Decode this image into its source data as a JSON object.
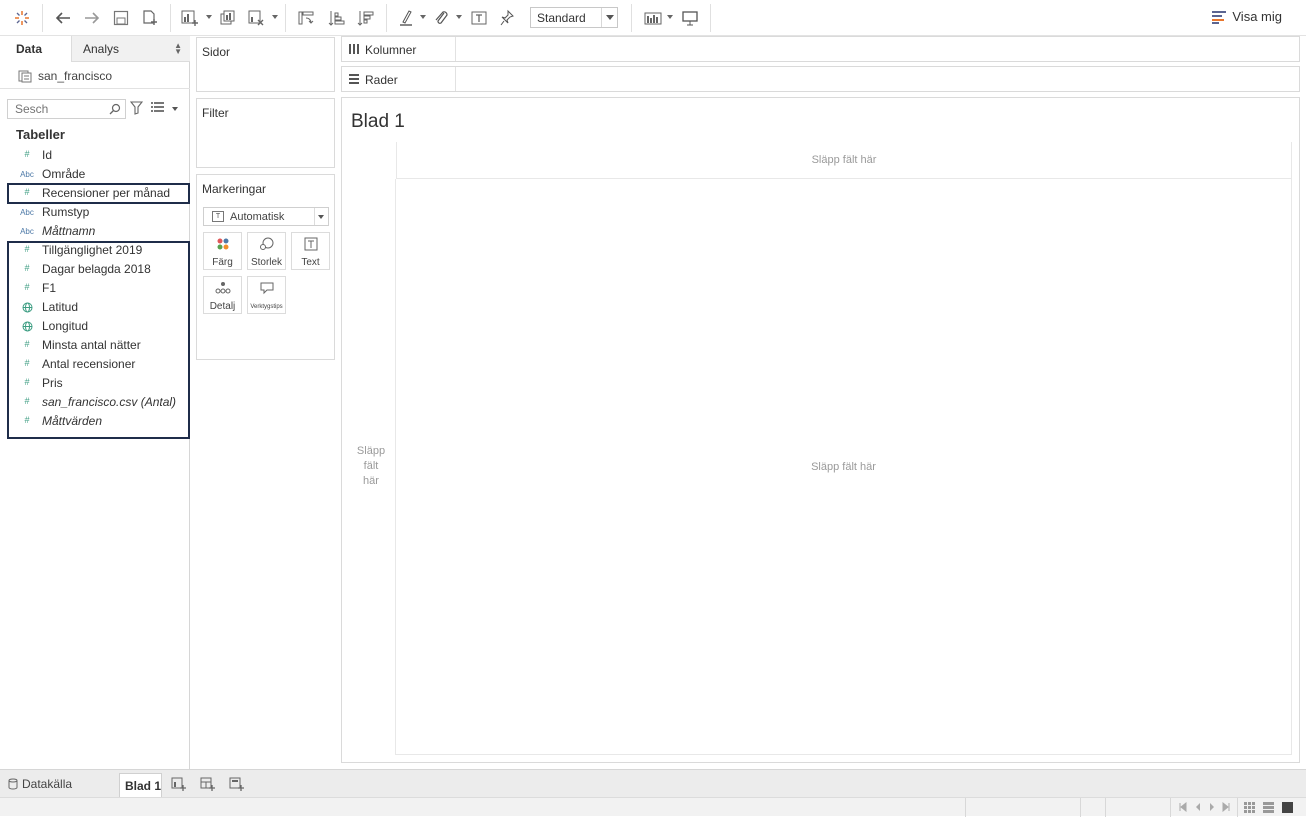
{
  "toolbar": {
    "present_mode_select": "Standard",
    "show_me_label": "Visa mig"
  },
  "left_pane": {
    "tabs": {
      "data": "Data",
      "analys": "Analys"
    },
    "datasource": "san_francisco",
    "search_placeholder": "Sesch",
    "tables_heading": "Tabeller",
    "fields": [
      {
        "label": "Id",
        "type": "number",
        "italic": false
      },
      {
        "label": "Område",
        "type": "text",
        "italic": false
      },
      {
        "label": "Recensioner per månad",
        "type": "number",
        "italic": false
      },
      {
        "label": "Rumstyp",
        "type": "text",
        "italic": false
      },
      {
        "label": "Måttnamn",
        "type": "text",
        "italic": true
      },
      {
        "label": "Tillgänglighet 2019",
        "type": "number",
        "italic": false
      },
      {
        "label": "Dagar belagda 2018",
        "type": "number",
        "italic": false
      },
      {
        "label": "F1",
        "type": "number",
        "italic": false
      },
      {
        "label": "Latitud",
        "type": "geo",
        "italic": false
      },
      {
        "label": "Longitud",
        "type": "geo",
        "italic": false
      },
      {
        "label": "Minsta antal nätter",
        "type": "number",
        "italic": false
      },
      {
        "label": "Antal recensioner",
        "type": "number",
        "italic": false
      },
      {
        "label": "Pris",
        "type": "number",
        "italic": false
      },
      {
        "label": "san_francisco.csv (Antal)",
        "type": "number",
        "italic": true
      },
      {
        "label": "Måttvärden",
        "type": "number",
        "italic": true
      }
    ],
    "field_type_icons": {
      "number": "#",
      "text": "Abc",
      "geo": "globe"
    }
  },
  "cards": {
    "pages": "Sidor",
    "filters": "Filter",
    "marks": "Markeringar",
    "marks_type": "Automatisk",
    "marks_buttons": {
      "color": "Färg",
      "size": "Storlek",
      "text": "Text",
      "detail": "Detalj",
      "tooltip": "Verktygstips"
    }
  },
  "shelves": {
    "columns": "Kolumner",
    "rows": "Rader"
  },
  "view": {
    "sheet_title": "Blad 1",
    "drop_top": "Släpp fält här",
    "drop_left": "Släpp fält här",
    "drop_main": "Släpp fält här"
  },
  "bottom": {
    "datasource_tab": "Datakälla",
    "sheet_tab": "Blad 1"
  },
  "colors": {
    "measure_green": "#3c9d82",
    "dimension_blue": "#4d79a7",
    "selection_border": "#1f2d4a",
    "drop_hint": "#9a9a9a"
  }
}
